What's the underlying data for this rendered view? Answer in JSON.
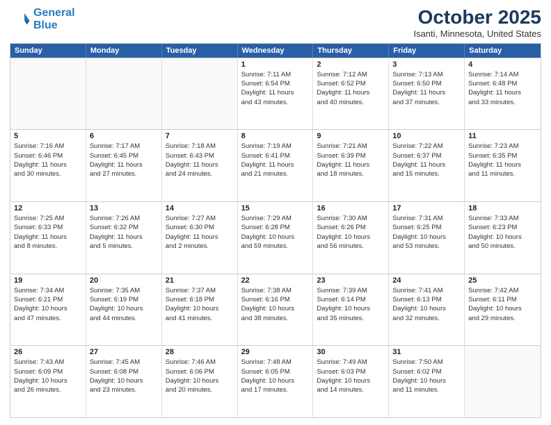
{
  "logo": {
    "line1": "General",
    "line2": "Blue"
  },
  "title": "October 2025",
  "subtitle": "Isanti, Minnesota, United States",
  "header_days": [
    "Sunday",
    "Monday",
    "Tuesday",
    "Wednesday",
    "Thursday",
    "Friday",
    "Saturday"
  ],
  "weeks": [
    [
      {
        "day": "",
        "empty": true
      },
      {
        "day": "",
        "empty": true
      },
      {
        "day": "",
        "empty": true
      },
      {
        "day": "1",
        "lines": [
          "Sunrise: 7:11 AM",
          "Sunset: 6:54 PM",
          "Daylight: 11 hours",
          "and 43 minutes."
        ]
      },
      {
        "day": "2",
        "lines": [
          "Sunrise: 7:12 AM",
          "Sunset: 6:52 PM",
          "Daylight: 11 hours",
          "and 40 minutes."
        ]
      },
      {
        "day": "3",
        "lines": [
          "Sunrise: 7:13 AM",
          "Sunset: 6:50 PM",
          "Daylight: 11 hours",
          "and 37 minutes."
        ]
      },
      {
        "day": "4",
        "lines": [
          "Sunrise: 7:14 AM",
          "Sunset: 6:48 PM",
          "Daylight: 11 hours",
          "and 33 minutes."
        ]
      }
    ],
    [
      {
        "day": "5",
        "lines": [
          "Sunrise: 7:16 AM",
          "Sunset: 6:46 PM",
          "Daylight: 11 hours",
          "and 30 minutes."
        ]
      },
      {
        "day": "6",
        "lines": [
          "Sunrise: 7:17 AM",
          "Sunset: 6:45 PM",
          "Daylight: 11 hours",
          "and 27 minutes."
        ]
      },
      {
        "day": "7",
        "lines": [
          "Sunrise: 7:18 AM",
          "Sunset: 6:43 PM",
          "Daylight: 11 hours",
          "and 24 minutes."
        ]
      },
      {
        "day": "8",
        "lines": [
          "Sunrise: 7:19 AM",
          "Sunset: 6:41 PM",
          "Daylight: 11 hours",
          "and 21 minutes."
        ]
      },
      {
        "day": "9",
        "lines": [
          "Sunrise: 7:21 AM",
          "Sunset: 6:39 PM",
          "Daylight: 11 hours",
          "and 18 minutes."
        ]
      },
      {
        "day": "10",
        "lines": [
          "Sunrise: 7:22 AM",
          "Sunset: 6:37 PM",
          "Daylight: 11 hours",
          "and 15 minutes."
        ]
      },
      {
        "day": "11",
        "lines": [
          "Sunrise: 7:23 AM",
          "Sunset: 6:35 PM",
          "Daylight: 11 hours",
          "and 11 minutes."
        ]
      }
    ],
    [
      {
        "day": "12",
        "lines": [
          "Sunrise: 7:25 AM",
          "Sunset: 6:33 PM",
          "Daylight: 11 hours",
          "and 8 minutes."
        ]
      },
      {
        "day": "13",
        "lines": [
          "Sunrise: 7:26 AM",
          "Sunset: 6:32 PM",
          "Daylight: 11 hours",
          "and 5 minutes."
        ]
      },
      {
        "day": "14",
        "lines": [
          "Sunrise: 7:27 AM",
          "Sunset: 6:30 PM",
          "Daylight: 11 hours",
          "and 2 minutes."
        ]
      },
      {
        "day": "15",
        "lines": [
          "Sunrise: 7:29 AM",
          "Sunset: 6:28 PM",
          "Daylight: 10 hours",
          "and 59 minutes."
        ]
      },
      {
        "day": "16",
        "lines": [
          "Sunrise: 7:30 AM",
          "Sunset: 6:26 PM",
          "Daylight: 10 hours",
          "and 56 minutes."
        ]
      },
      {
        "day": "17",
        "lines": [
          "Sunrise: 7:31 AM",
          "Sunset: 6:25 PM",
          "Daylight: 10 hours",
          "and 53 minutes."
        ]
      },
      {
        "day": "18",
        "lines": [
          "Sunrise: 7:33 AM",
          "Sunset: 6:23 PM",
          "Daylight: 10 hours",
          "and 50 minutes."
        ]
      }
    ],
    [
      {
        "day": "19",
        "lines": [
          "Sunrise: 7:34 AM",
          "Sunset: 6:21 PM",
          "Daylight: 10 hours",
          "and 47 minutes."
        ]
      },
      {
        "day": "20",
        "lines": [
          "Sunrise: 7:35 AM",
          "Sunset: 6:19 PM",
          "Daylight: 10 hours",
          "and 44 minutes."
        ]
      },
      {
        "day": "21",
        "lines": [
          "Sunrise: 7:37 AM",
          "Sunset: 6:18 PM",
          "Daylight: 10 hours",
          "and 41 minutes."
        ]
      },
      {
        "day": "22",
        "lines": [
          "Sunrise: 7:38 AM",
          "Sunset: 6:16 PM",
          "Daylight: 10 hours",
          "and 38 minutes."
        ]
      },
      {
        "day": "23",
        "lines": [
          "Sunrise: 7:39 AM",
          "Sunset: 6:14 PM",
          "Daylight: 10 hours",
          "and 35 minutes."
        ]
      },
      {
        "day": "24",
        "lines": [
          "Sunrise: 7:41 AM",
          "Sunset: 6:13 PM",
          "Daylight: 10 hours",
          "and 32 minutes."
        ]
      },
      {
        "day": "25",
        "lines": [
          "Sunrise: 7:42 AM",
          "Sunset: 6:11 PM",
          "Daylight: 10 hours",
          "and 29 minutes."
        ]
      }
    ],
    [
      {
        "day": "26",
        "lines": [
          "Sunrise: 7:43 AM",
          "Sunset: 6:09 PM",
          "Daylight: 10 hours",
          "and 26 minutes."
        ]
      },
      {
        "day": "27",
        "lines": [
          "Sunrise: 7:45 AM",
          "Sunset: 6:08 PM",
          "Daylight: 10 hours",
          "and 23 minutes."
        ]
      },
      {
        "day": "28",
        "lines": [
          "Sunrise: 7:46 AM",
          "Sunset: 6:06 PM",
          "Daylight: 10 hours",
          "and 20 minutes."
        ]
      },
      {
        "day": "29",
        "lines": [
          "Sunrise: 7:48 AM",
          "Sunset: 6:05 PM",
          "Daylight: 10 hours",
          "and 17 minutes."
        ]
      },
      {
        "day": "30",
        "lines": [
          "Sunrise: 7:49 AM",
          "Sunset: 6:03 PM",
          "Daylight: 10 hours",
          "and 14 minutes."
        ]
      },
      {
        "day": "31",
        "lines": [
          "Sunrise: 7:50 AM",
          "Sunset: 6:02 PM",
          "Daylight: 10 hours",
          "and 11 minutes."
        ]
      },
      {
        "day": "",
        "empty": true
      }
    ]
  ]
}
